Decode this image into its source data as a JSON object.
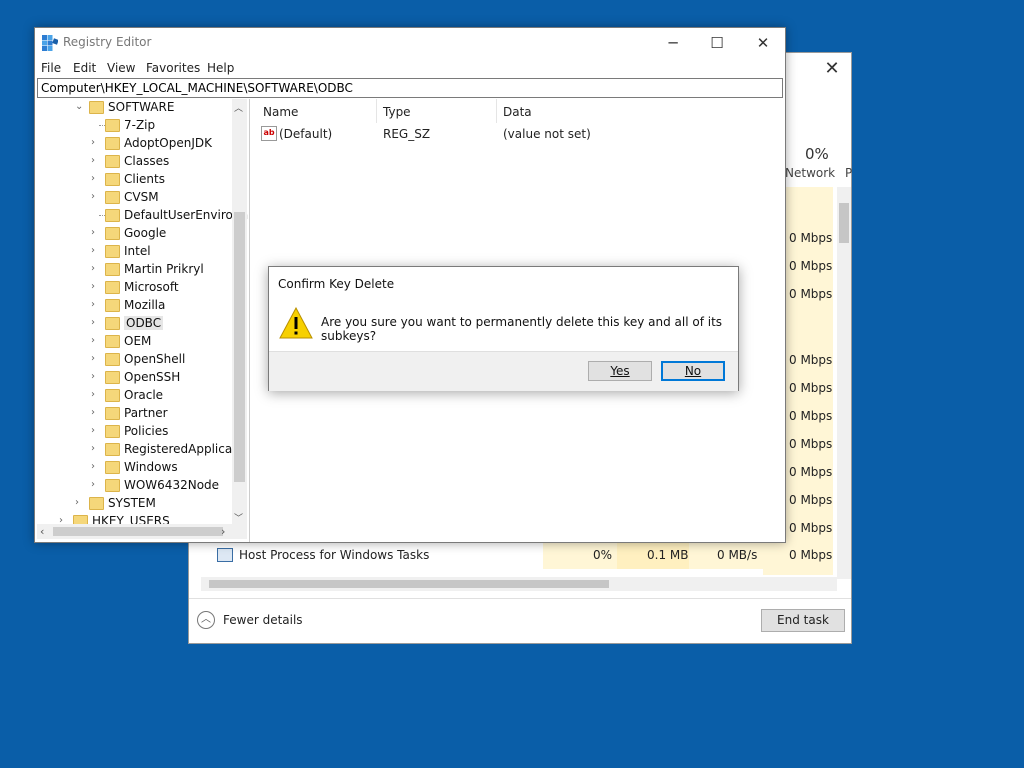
{
  "task_manager": {
    "header_percent": "0%",
    "header_network": "Network",
    "header_p": "P",
    "network_values": [
      "0 Mbps",
      "0 Mbps",
      "0 Mbps",
      "0 Mbps",
      "0 Mbps",
      "0 Mbps",
      "0 Mbps",
      "0 Mbps",
      "0 Mbps",
      "0 Mbps",
      "0 Mbps"
    ],
    "process_row": {
      "name": "Host Process for Windows Tasks",
      "cpu": "0%",
      "memory": "0.1 MB",
      "disk": "0 MB/s",
      "network": "0 Mbps"
    },
    "fewer_details": "Fewer details",
    "end_task": "End task"
  },
  "registry_editor": {
    "title": "Registry Editor",
    "menu": [
      "File",
      "Edit",
      "View",
      "Favorites",
      "Help"
    ],
    "address": "Computer\\HKEY_LOCAL_MACHINE\\SOFTWARE\\ODBC",
    "tree": {
      "software": "SOFTWARE",
      "children": [
        "7-Zip",
        "AdoptOpenJDK",
        "Classes",
        "Clients",
        "CVSM",
        "DefaultUserEnvironn",
        "Google",
        "Intel",
        "Martin Prikryl",
        "Microsoft",
        "Mozilla",
        "ODBC",
        "OEM",
        "OpenShell",
        "OpenSSH",
        "Oracle",
        "Partner",
        "Policies",
        "RegisteredApplicatio",
        "Windows",
        "WOW6432Node"
      ],
      "system": "SYSTEM",
      "hkey_users": "HKEY_USERS",
      "selected": "ODBC"
    },
    "columns": {
      "name": "Name",
      "type": "Type",
      "data": "Data"
    },
    "values": [
      {
        "name": "(Default)",
        "type": "REG_SZ",
        "data": "(value not set)"
      }
    ]
  },
  "dialog": {
    "title": "Confirm Key Delete",
    "message": "Are you sure you want to permanently delete this key and all of its subkeys?",
    "yes": "Yes",
    "no": "No"
  }
}
